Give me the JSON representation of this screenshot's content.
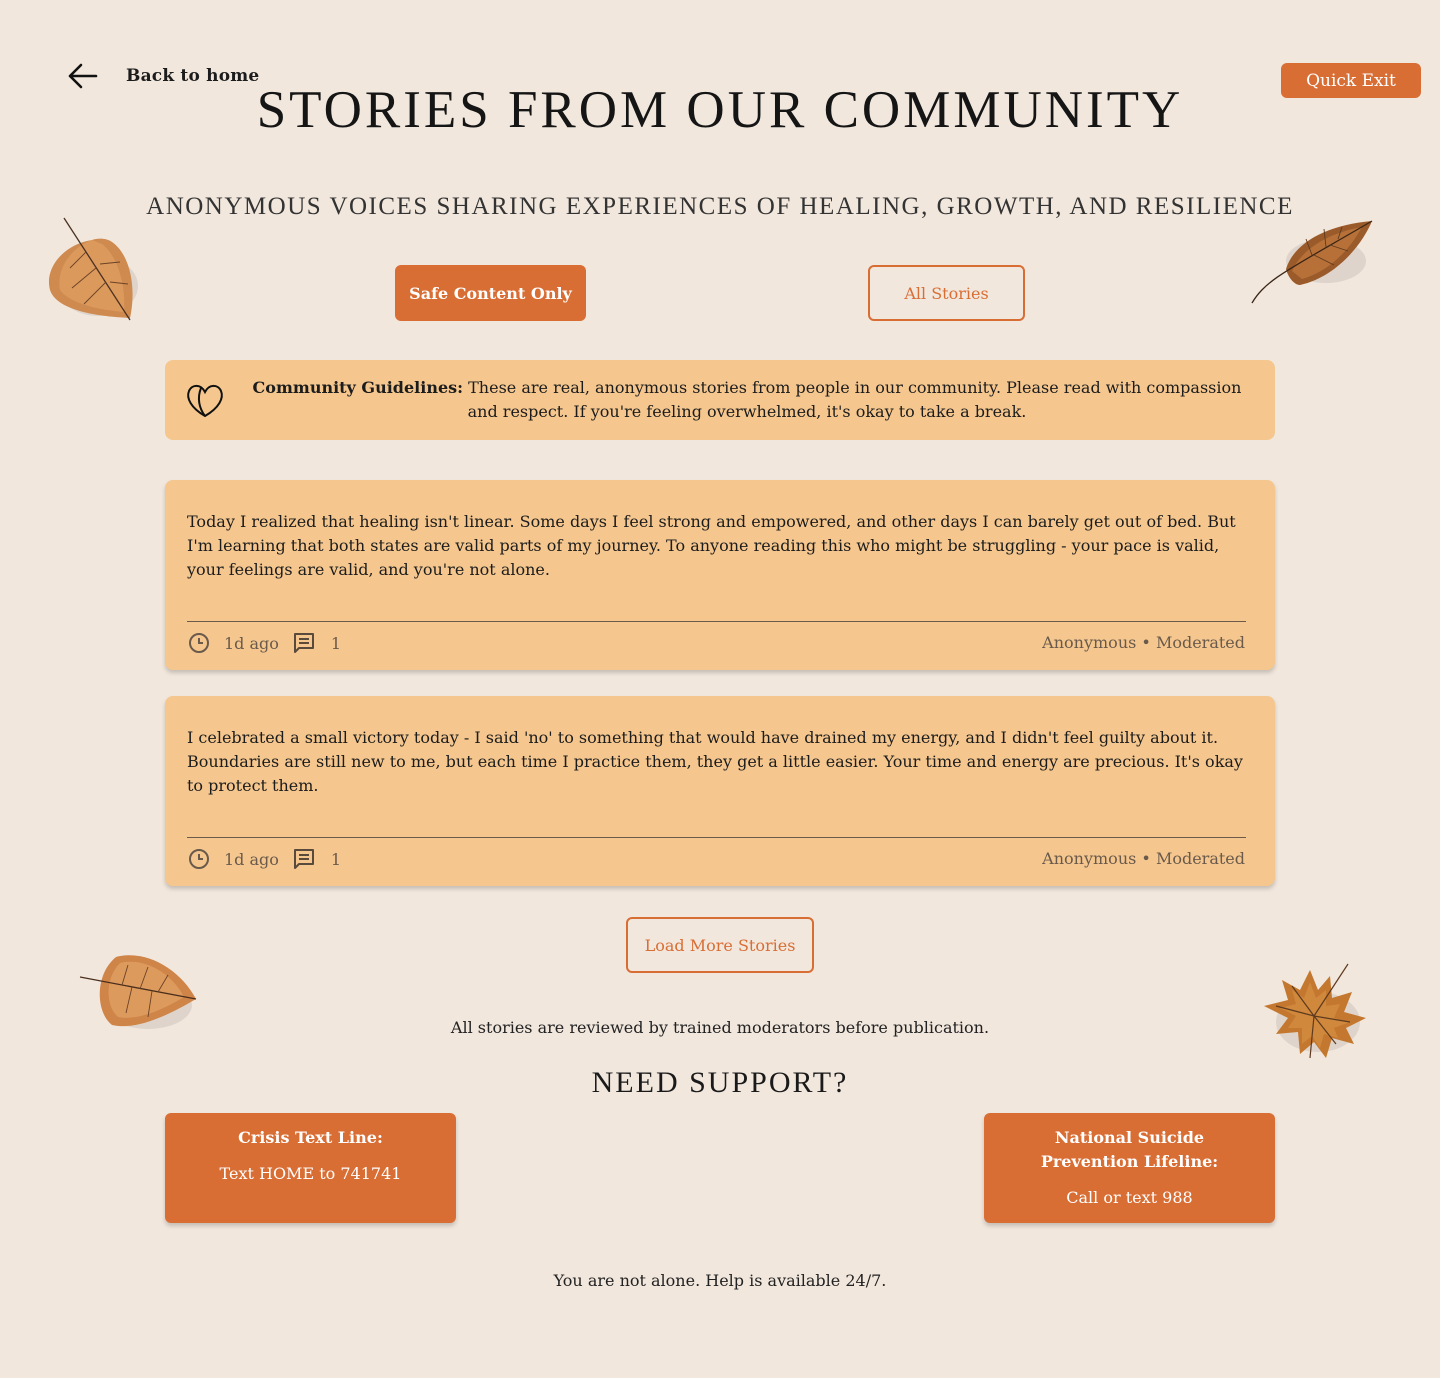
{
  "nav": {
    "back_label": "Back to home",
    "quick_exit_label": "Quick Exit"
  },
  "header": {
    "title": "STORIES FROM OUR COMMUNITY",
    "subtitle": "ANONYMOUS VOICES SHARING EXPERIENCES OF HEALING, GROWTH, AND RESILIENCE"
  },
  "filters": {
    "safe_label": "Safe Content Only",
    "all_label": "All Stories"
  },
  "guidelines": {
    "heading": "Community Guidelines:",
    "text": " These are real, anonymous stories from people in our community. Please read with compassion and respect. If you're feeling overwhelmed, it's okay to take a break."
  },
  "stories": [
    {
      "body": "Today I realized that healing isn't linear. Some days I feel strong and empowered, and other days I can barely get out of bed. But I'm learning that both states are valid parts of my journey. To anyone reading this who might be struggling - your pace is valid, your feelings are valid, and you're not alone.",
      "time": "1d ago",
      "comments": "1",
      "author": "Anonymous • Moderated"
    },
    {
      "body": "I celebrated a small victory today - I said 'no' to something that would have drained my energy, and I didn't feel guilty about it. Boundaries are still new to me, but each time I practice them, they get a little easier. Your time and energy are precious. It's okay to protect them.",
      "time": "1d ago",
      "comments": "1",
      "author": "Anonymous • Moderated"
    }
  ],
  "load_more_label": "Load More Stories",
  "moderation_note": "All stories are reviewed by trained moderators before publication.",
  "support": {
    "heading": "NEED SUPPORT?",
    "cards": [
      {
        "name": "Crisis Text Line:",
        "action": "Text HOME to 741741"
      },
      {
        "name": "National Suicide Prevention Lifeline:",
        "action": "Call or text 988"
      }
    ]
  },
  "footer_note": "You are not alone. Help is available 24/7.",
  "colors": {
    "accent": "#d96e35",
    "card": "#f5c78e",
    "background": "#f1e7dd"
  }
}
